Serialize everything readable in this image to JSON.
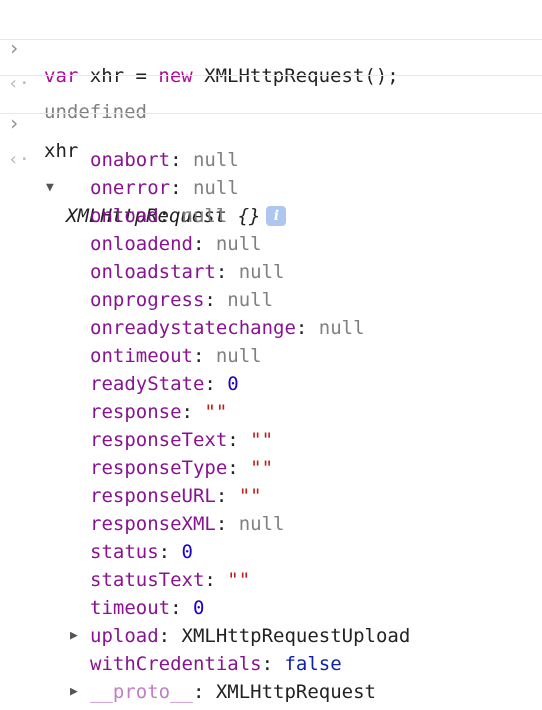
{
  "console": {
    "entries": [
      {
        "prompt_icon": "chevron-right-icon",
        "input": {
          "kw1": "var",
          "mid": " xhr = ",
          "kw2": "new",
          "rest": " XMLHttpRequest();"
        }
      },
      {
        "result_icon": "result-arrow-icon",
        "result": "undefined"
      },
      {
        "prompt_icon": "chevron-right-icon",
        "input_text": "xhr"
      }
    ],
    "object": {
      "name": "XMLHttpRequest {}",
      "info_badge": "i",
      "properties": [
        {
          "key": "onabort",
          "value": "null"
        },
        {
          "key": "onerror",
          "value": "null"
        },
        {
          "key": "onload",
          "value": "null"
        },
        {
          "key": "onloadend",
          "value": "null"
        },
        {
          "key": "onloadstart",
          "value": "null"
        },
        {
          "key": "onprogress",
          "value": "null"
        },
        {
          "key": "onreadystatechange",
          "value": "null"
        },
        {
          "key": "ontimeout",
          "value": "null"
        },
        {
          "key": "readyState",
          "value": "0"
        },
        {
          "key": "response",
          "value": "\"\""
        },
        {
          "key": "responseText",
          "value": "\"\""
        },
        {
          "key": "responseType",
          "value": "\"\""
        },
        {
          "key": "responseURL",
          "value": "\"\""
        },
        {
          "key": "responseXML",
          "value": "null"
        },
        {
          "key": "status",
          "value": "0"
        },
        {
          "key": "statusText",
          "value": "\"\""
        },
        {
          "key": "timeout",
          "value": "0"
        },
        {
          "key": "upload",
          "value": "XMLHttpRequestUpload"
        },
        {
          "key": "withCredentials",
          "value": "false"
        },
        {
          "key": "__proto__",
          "value": "XMLHttpRequest"
        }
      ]
    }
  },
  "colors": {
    "keyword": "#a90d91",
    "property_key": "#881391",
    "null": "#808080",
    "number": "#1c00cf",
    "string": "#c41a16",
    "boolean": "#0d22aa"
  }
}
